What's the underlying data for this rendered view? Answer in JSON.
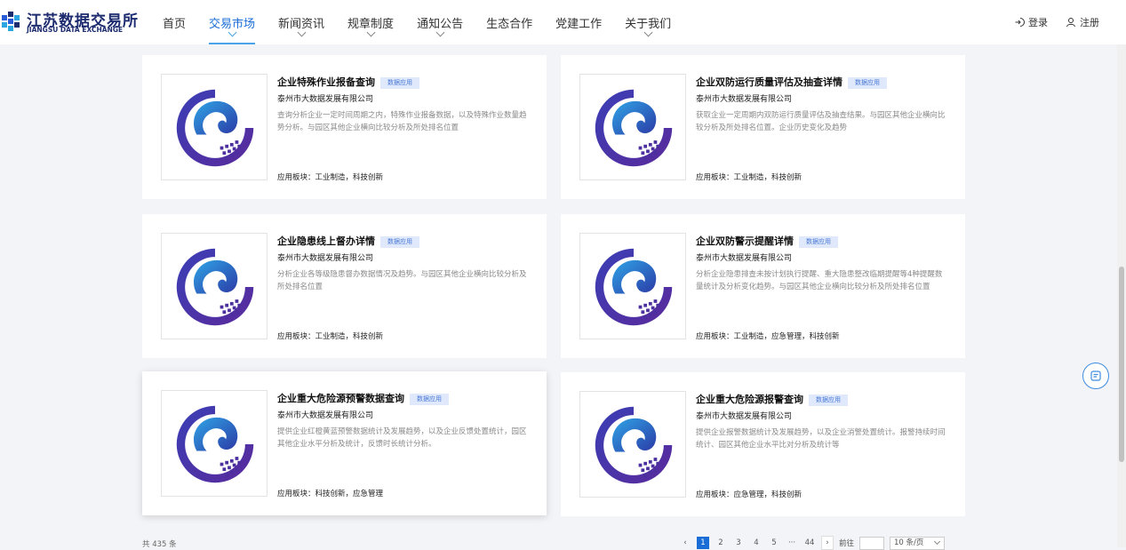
{
  "header": {
    "logo_cn": "江苏数据交易所",
    "logo_en": "JIANGSU DATA EXCHANGE",
    "nav": [
      {
        "label": "首页",
        "has_dropdown": false,
        "active": false
      },
      {
        "label": "交易市场",
        "has_dropdown": true,
        "active": true
      },
      {
        "label": "新闻资讯",
        "has_dropdown": true,
        "active": false
      },
      {
        "label": "规章制度",
        "has_dropdown": true,
        "active": false
      },
      {
        "label": "通知公告",
        "has_dropdown": true,
        "active": false
      },
      {
        "label": "生态合作",
        "has_dropdown": false,
        "active": false
      },
      {
        "label": "党建工作",
        "has_dropdown": false,
        "active": false
      },
      {
        "label": "关于我们",
        "has_dropdown": true,
        "active": false
      }
    ],
    "login": "登录",
    "register": "注册"
  },
  "cards": [
    {
      "title": "企业特殊作业报备查询",
      "tag": "数据应用",
      "company": "泰州市大数据发展有限公司",
      "desc": "查询分析企业一定时间周期之内，特殊作业报备数据，以及特殊作业数量趋势分析。与园区其他企业横向比较分析及所处排名位置",
      "scope": "应用板块：工业制造，科技创新"
    },
    {
      "title": "企业双防运行质量评估及抽查详情",
      "tag": "数据应用",
      "company": "泰州市大数据发展有限公司",
      "desc": "获取企业一定周期内双防运行质量评估及抽查结果。与园区其他企业横向比较分析及所处排名位置。企业历史变化及趋势",
      "scope": "应用板块：工业制造，科技创新"
    },
    {
      "title": "企业隐患线上督办详情",
      "tag": "数据应用",
      "company": "泰州市大数据发展有限公司",
      "desc": "分析企业各等级隐患督办数据情况及趋势。与园区其他企业横向比较分析及所处排名位置",
      "scope": "应用板块：工业制造，科技创新"
    },
    {
      "title": "企业双防警示提醒详情",
      "tag": "数据应用",
      "company": "泰州市大数据发展有限公司",
      "desc": "分析企业隐患排查未按计划执行提醒、重大隐患整改临期提醒等4种提醒数量统计及分析变化趋势。与园区其他企业横向比较分析及所处排名位置",
      "scope": "应用板块：工业制造，应急管理，科技创新"
    },
    {
      "title": "企业重大危险源预警数据查询",
      "tag": "数据应用",
      "company": "泰州市大数据发展有限公司",
      "desc": "提供企业红橙黄蓝预警数据统计及发展趋势，以及企业反馈处置统计，园区其他企业水平分析及统计，反馈时长统计分析。",
      "scope": "应用板块：科技创新，应急管理"
    },
    {
      "title": "企业重大危险源报警查询",
      "tag": "数据应用",
      "company": "泰州市大数据发展有限公司",
      "desc": "提供企业报警数据统计及发展趋势，以及企业消警处置统计。报警持续时间统计、园区其他企业水平比对分析及统计等",
      "scope": "应用板块：应急管理，科技创新"
    }
  ],
  "pagination": {
    "total": "共 435 条",
    "pages": [
      "1",
      "2",
      "3",
      "4",
      "5",
      "···",
      "44"
    ],
    "current": "1",
    "jump_label": "前往",
    "page_size": "10 条/页"
  }
}
